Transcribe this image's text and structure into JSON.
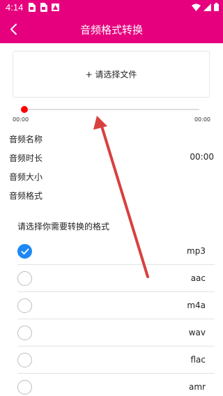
{
  "status_bar": {
    "time": "4:14",
    "color": "#e6007e"
  },
  "header": {
    "title": "音频格式转换",
    "back_icon": "chevron-left-icon"
  },
  "file_picker": {
    "label": "+ 请选择文件"
  },
  "player": {
    "current_time": "00:00",
    "total_time": "00:00",
    "progress": 0,
    "knob_color": "#ff0000"
  },
  "audio_info": {
    "name_label": "音频名称",
    "name_value": "",
    "duration_label": "音频时长",
    "duration_value": "00:00",
    "size_label": "音频大小",
    "size_value": "",
    "format_label": "音频格式",
    "format_value": ""
  },
  "format_section": {
    "title": "请选择你需要转换的格式",
    "selected": "mp3",
    "options": [
      {
        "name": "mp3",
        "checked": true
      },
      {
        "name": "aac",
        "checked": false
      },
      {
        "name": "m4a",
        "checked": false
      },
      {
        "name": "wav",
        "checked": false
      },
      {
        "name": "flac",
        "checked": false
      },
      {
        "name": "amr",
        "checked": false
      }
    ]
  },
  "colors": {
    "accent": "#e6007e",
    "radio_checked": "#1e88f5",
    "annotation_arrow": "#d8403f"
  }
}
